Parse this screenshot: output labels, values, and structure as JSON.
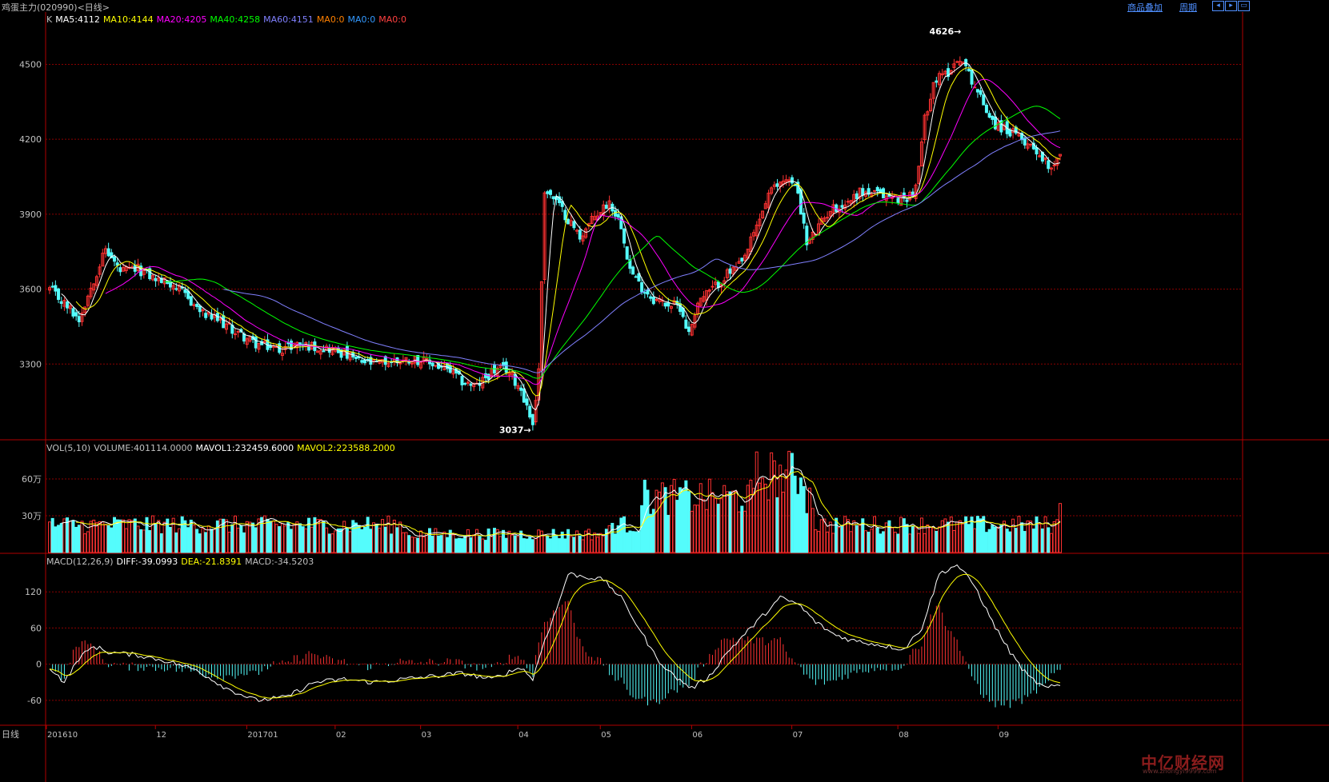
{
  "window": {
    "title": "鸡蛋主力(020990)<日线>",
    "links": {
      "overlay": "商品叠加",
      "period": "周期"
    },
    "nav_icons": [
      "back-icon",
      "forward-icon",
      "restore-icon"
    ]
  },
  "price_panel": {
    "legend": [
      {
        "text": "K",
        "color": "#c0c0c0"
      },
      {
        "text": "MA5:4112",
        "color": "#ffffff"
      },
      {
        "text": "MA10:4144",
        "color": "#ffff00"
      },
      {
        "text": "MA20:4205",
        "color": "#ff00ff"
      },
      {
        "text": "MA40:4258",
        "color": "#00ff00"
      },
      {
        "text": "MA60:4151",
        "color": "#8080ff"
      },
      {
        "text": "MA0:0",
        "color": "#ff8000"
      },
      {
        "text": "MA0:0",
        "color": "#3399ff"
      },
      {
        "text": "MA0:0",
        "color": "#ff4040"
      }
    ],
    "yticks": [
      "4500",
      "4200",
      "3900",
      "3600",
      "3300"
    ],
    "high_label": "4626",
    "low_label": "3037"
  },
  "volume_panel": {
    "legend": [
      {
        "text": "VOL(5,10)",
        "color": "#c0c0c0"
      },
      {
        "text": "VOLUME:401114.0000",
        "color": "#c0c0c0"
      },
      {
        "text": "MAVOL1:232459.6000",
        "color": "#ffffff"
      },
      {
        "text": "MAVOL2:223588.2000",
        "color": "#ffff00"
      }
    ],
    "yticks": [
      "60万",
      "30万"
    ]
  },
  "macd_panel": {
    "legend": [
      {
        "text": "MACD(12,26,9)",
        "color": "#c0c0c0"
      },
      {
        "text": "DIFF:-39.0993",
        "color": "#ffffff"
      },
      {
        "text": "DEA:-21.8391",
        "color": "#ffff00"
      },
      {
        "text": "MACD:-34.5203",
        "color": "#c0c0c0"
      }
    ],
    "yticks": [
      "120",
      "60",
      "0",
      "-60"
    ]
  },
  "xaxis": {
    "period_label": "日线",
    "labels": [
      "201610",
      "12",
      "201701",
      "02",
      "03",
      "04",
      "05",
      "06",
      "07",
      "08",
      "09"
    ]
  },
  "watermark": {
    "main": "中亿财经网",
    "sub": "www.zhongyi9999.com"
  },
  "colors": {
    "up": "#ff3232",
    "down": "#54fcfc",
    "grid": "#8b0000",
    "axis": "#b00000",
    "label": "#c0c0c0"
  },
  "chart_data": {
    "type": "candlestick",
    "price_ylim": [
      3000,
      4700
    ],
    "price_yticks": [
      4500,
      4200,
      3900,
      3600,
      3300
    ],
    "volume_ylim": [
      0,
      90
    ],
    "volume_unit": "万",
    "volume_yticks": [
      60,
      30
    ],
    "macd_ylim": [
      -100,
      180
    ],
    "macd_yticks": [
      120,
      60,
      0,
      -60
    ],
    "high": 4626,
    "low": 3037,
    "last": {
      "MA5": 4112,
      "MA10": 4144,
      "MA20": 4205,
      "MA40": 4258,
      "MA60": 4151,
      "VOLUME": 401114.0,
      "MAVOL1": 232459.6,
      "MAVOL2": 223588.2,
      "DIFF": -39.0993,
      "DEA": -21.8391,
      "MACD": -34.5203
    },
    "close_anchors": [
      [
        0,
        3600
      ],
      [
        6,
        3530
      ],
      [
        10,
        3480
      ],
      [
        15,
        3640
      ],
      [
        19,
        3760
      ],
      [
        24,
        3670
      ],
      [
        30,
        3680
      ],
      [
        36,
        3640
      ],
      [
        42,
        3620
      ],
      [
        48,
        3550
      ],
      [
        52,
        3500
      ],
      [
        58,
        3470
      ],
      [
        63,
        3430
      ],
      [
        70,
        3380
      ],
      [
        78,
        3360
      ],
      [
        84,
        3380
      ],
      [
        90,
        3370
      ],
      [
        96,
        3360
      ],
      [
        100,
        3340
      ],
      [
        105,
        3310
      ],
      [
        110,
        3300
      ],
      [
        116,
        3310
      ],
      [
        124,
        3320
      ],
      [
        130,
        3300
      ],
      [
        136,
        3270
      ],
      [
        140,
        3230
      ],
      [
        145,
        3210
      ],
      [
        150,
        3270
      ],
      [
        155,
        3280
      ],
      [
        160,
        3200
      ],
      [
        164,
        3060
      ],
      [
        166,
        3270
      ],
      [
        168,
        4000
      ],
      [
        172,
        3950
      ],
      [
        176,
        3880
      ],
      [
        180,
        3810
      ],
      [
        185,
        3890
      ],
      [
        190,
        3950
      ],
      [
        194,
        3860
      ],
      [
        197,
        3680
      ],
      [
        200,
        3620
      ],
      [
        205,
        3560
      ],
      [
        210,
        3540
      ],
      [
        214,
        3530
      ],
      [
        217,
        3420
      ],
      [
        220,
        3550
      ],
      [
        225,
        3600
      ],
      [
        230,
        3660
      ],
      [
        235,
        3700
      ],
      [
        240,
        3850
      ],
      [
        244,
        3980
      ],
      [
        250,
        4050
      ],
      [
        254,
        3990
      ],
      [
        257,
        3780
      ],
      [
        260,
        3830
      ],
      [
        265,
        3920
      ],
      [
        270,
        3940
      ],
      [
        275,
        3990
      ],
      [
        280,
        3980
      ],
      [
        285,
        3970
      ],
      [
        290,
        3960
      ],
      [
        294,
        4000
      ],
      [
        297,
        4280
      ],
      [
        300,
        4430
      ],
      [
        305,
        4470
      ],
      [
        309,
        4530
      ],
      [
        313,
        4440
      ],
      [
        317,
        4340
      ],
      [
        321,
        4260
      ],
      [
        326,
        4230
      ],
      [
        330,
        4200
      ],
      [
        334,
        4170
      ],
      [
        338,
        4110
      ],
      [
        340,
        4090
      ],
      [
        343,
        4150
      ]
    ],
    "macd_anchors": [
      [
        0,
        -5
      ],
      [
        5,
        -30
      ],
      [
        10,
        10
      ],
      [
        15,
        30
      ],
      [
        20,
        20
      ],
      [
        30,
        15
      ],
      [
        40,
        5
      ],
      [
        50,
        -10
      ],
      [
        60,
        -40
      ],
      [
        70,
        -60
      ],
      [
        80,
        -55
      ],
      [
        90,
        -30
      ],
      [
        100,
        -25
      ],
      [
        110,
        -30
      ],
      [
        120,
        -25
      ],
      [
        130,
        -20
      ],
      [
        140,
        -15
      ],
      [
        150,
        -25
      ],
      [
        160,
        -5
      ],
      [
        164,
        -25
      ],
      [
        168,
        40
      ],
      [
        172,
        90
      ],
      [
        176,
        150
      ],
      [
        182,
        145
      ],
      [
        188,
        140
      ],
      [
        194,
        110
      ],
      [
        200,
        60
      ],
      [
        206,
        10
      ],
      [
        212,
        -20
      ],
      [
        218,
        -40
      ],
      [
        224,
        -20
      ],
      [
        230,
        20
      ],
      [
        236,
        50
      ],
      [
        242,
        80
      ],
      [
        248,
        110
      ],
      [
        254,
        100
      ],
      [
        260,
        70
      ],
      [
        266,
        50
      ],
      [
        272,
        40
      ],
      [
        278,
        35
      ],
      [
        284,
        30
      ],
      [
        290,
        25
      ],
      [
        296,
        60
      ],
      [
        302,
        150
      ],
      [
        308,
        165
      ],
      [
        314,
        130
      ],
      [
        320,
        70
      ],
      [
        326,
        20
      ],
      [
        332,
        -20
      ],
      [
        338,
        -40
      ],
      [
        343,
        -35
      ]
    ],
    "x_label_positions": [
      0,
      37,
      68,
      98,
      127,
      160,
      188,
      219,
      253,
      289,
      323
    ]
  }
}
